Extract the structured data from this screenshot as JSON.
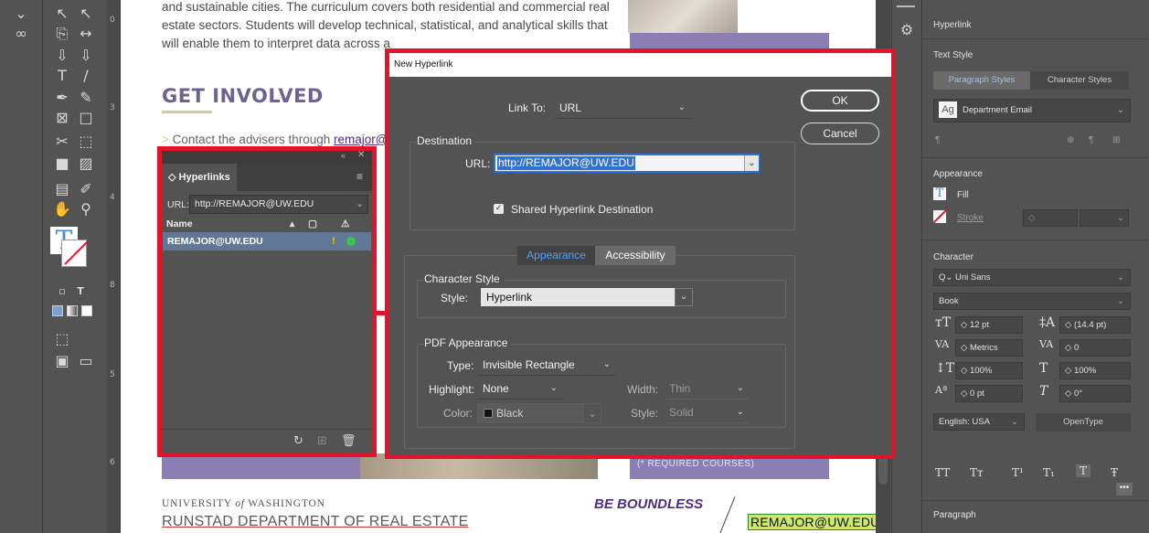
{
  "document": {
    "body_line1": "and sustainable cities. The curriculum covers both residential and commercial real",
    "body_line2": "estate sectors. Students will develop technical, statistical, and analytical skills that",
    "body_line3": "will enable them to interpret data across a",
    "heading": "GET INVOLVED",
    "contact_prefix": "> ",
    "contact_text": "Contact the advisers through ",
    "contact_link": "remajor@",
    "purple_box_text": "(* REQUIRED COURSES)",
    "uw_name_a": "UNIVERSITY ",
    "uw_name_of": "of",
    "uw_name_b": " WASHINGTON",
    "department": "RUNSTAD DEPARTMENT OF REAL ESTATE",
    "tagline": "BE BOUNDLESS",
    "footer_email": "REMAJOR@UW.EDU"
  },
  "ruler_numbers": [
    "0",
    "3",
    "4",
    "8",
    "5",
    "6"
  ],
  "hyperlinks_panel": {
    "tab_title": "Hyperlinks",
    "url_label": "URL:",
    "url_value": "http://REMAJOR@UW.EDU",
    "column_name": "Name",
    "row_name": "REMAJOR@UW.EDU"
  },
  "dialog": {
    "title": "New Hyperlink",
    "link_to_label": "Link To:",
    "link_to_value": "URL",
    "ok_label": "OK",
    "cancel_label": "Cancel",
    "destination_title": "Destination",
    "url_label": "URL:",
    "url_value": "http://REMAJOR@UW.EDU",
    "shared_label": "Shared Hyperlink Destination",
    "tab_appearance": "Appearance",
    "tab_accessibility": "Accessibility",
    "char_style_title": "Character Style",
    "style_label": "Style:",
    "style_value": "Hyperlink",
    "pdf_title": "PDF Appearance",
    "type_label": "Type:",
    "type_value": "Invisible Rectangle",
    "highlight_label": "Highlight:",
    "highlight_value": "None",
    "width_label": "Width:",
    "width_value": "Thin",
    "color_label": "Color:",
    "color_value": "Black",
    "style2_label": "Style:",
    "style2_value": "Solid"
  },
  "properties": {
    "title": "Hyperlink",
    "text_style": "Text Style",
    "tab_paragraph": "Paragraph Styles",
    "tab_character": "Character Styles",
    "style_sample": "Ag",
    "style_name": "Department Email",
    "appearance": "Appearance",
    "fill": "Fill",
    "stroke": "Stroke",
    "character": "Character",
    "font_family": "Uni Sans",
    "font_style": "Book",
    "font_size": "12 pt",
    "leading": "(14.4 pt)",
    "kerning": "Metrics",
    "tracking": "0",
    "vscale": "100%",
    "hscale": "100%",
    "baseline": "0 pt",
    "skew": "0°",
    "language": "English: USA",
    "opentype": "OpenType",
    "paragraph": "Paragraph"
  },
  "colors": {
    "highlight_red": "#e3142a",
    "selection_blue": "#2f72d6",
    "uw_purple": "#4b2e83",
    "status_green": "#3cc14b"
  }
}
